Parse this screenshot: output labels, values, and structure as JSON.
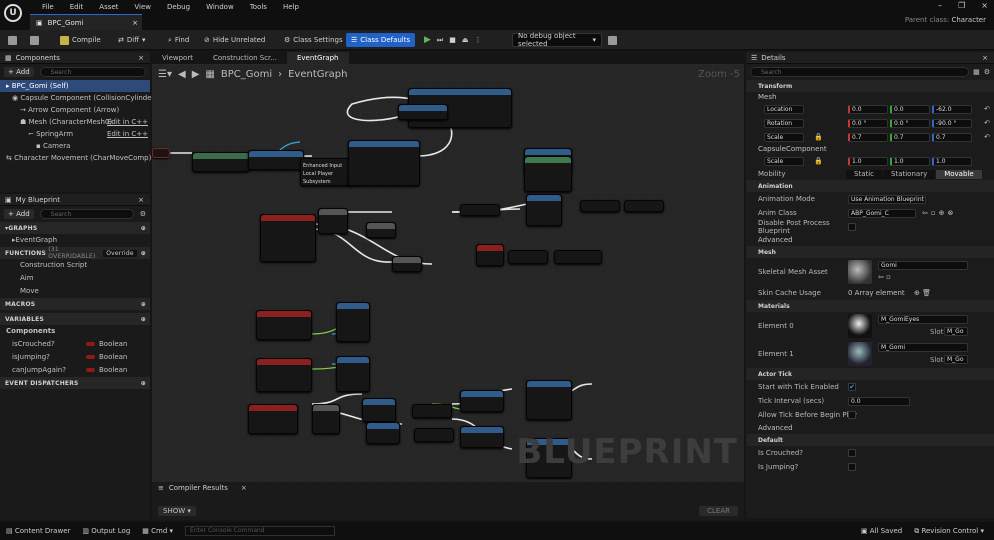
{
  "app": {
    "logo": "U",
    "doc_tab": "BPC_Gomi",
    "parent_label": "Parent class:",
    "parent_value": "Character"
  },
  "menu": [
    "File",
    "Edit",
    "Asset",
    "View",
    "Debug",
    "Window",
    "Tools",
    "Help"
  ],
  "toolbar": {
    "compile": "Compile",
    "diff": "Diff",
    "find": "Find",
    "hide_unrelated": "Hide Unrelated",
    "class_settings": "Class Settings",
    "class_defaults": "Class Defaults",
    "debug_object": "No debug object selected"
  },
  "components": {
    "title": "Components",
    "add": "+ Add",
    "search_placeholder": "Search",
    "tree": [
      {
        "label": "BPC_Gomi (Self)",
        "extra": ""
      },
      {
        "label": "Capsule Component (CollisionCylinder)",
        "extra": ""
      },
      {
        "label": "Arrow Component (Arrow)",
        "extra": "Edit in C++"
      },
      {
        "label": "Mesh (CharacterMesh0)",
        "extra": "Edit in C++"
      },
      {
        "label": "SpringArm",
        "extra": ""
      },
      {
        "label": "Camera",
        "extra": ""
      },
      {
        "label": "Character Movement (CharMoveComp)",
        "extra": ""
      }
    ]
  },
  "my_blueprint": {
    "title": "My Blueprint",
    "add": "+ Add",
    "search_placeholder": "Search",
    "graphs": "GRAPHS",
    "event_graph": "EventGraph",
    "functions": "FUNCTIONS",
    "functions_count": "(31 OVERRIDABLE)",
    "override": "Override",
    "function_items": [
      "Construction Script",
      "Aim",
      "Move"
    ],
    "macros": "MACROS",
    "variables": "VARIABLES",
    "components_cat": "Components",
    "vars": [
      {
        "name": "isCrouched?",
        "type": "Boolean"
      },
      {
        "name": "isJumping?",
        "type": "Boolean"
      },
      {
        "name": "canJumpAgain?",
        "type": "Boolean"
      }
    ],
    "dispatchers": "EVENT DISPATCHERS"
  },
  "graph_tabs": [
    "Viewport",
    "Construction Scr...",
    "EventGraph"
  ],
  "breadcrumb": {
    "root": "BPC_Gomi",
    "page": "EventGraph"
  },
  "graph": {
    "zoom": "Zoom -5",
    "watermark": "BLUEPRINT",
    "node_text": "Enhanced Input Local Player Subsystem"
  },
  "compiler": {
    "title": "Compiler Results",
    "show": "SHOW",
    "clear": "CLEAR"
  },
  "details": {
    "title": "Details",
    "search_placeholder": "Search",
    "transform": "Transform",
    "mesh": "Mesh",
    "location": {
      "label": "Location",
      "x": "0.0",
      "y": "0.0",
      "z": "-62.0"
    },
    "rotation": {
      "label": "Rotation",
      "x": "0.0 °",
      "y": "0.0 °",
      "z": "-90.0 °"
    },
    "scale": {
      "label": "Scale",
      "x": "0.7",
      "y": "0.7",
      "z": "0.7"
    },
    "capsule": "CapsuleComponent",
    "cscale": {
      "label": "Scale",
      "x": "1.0",
      "y": "1.0",
      "z": "1.0"
    },
    "mobility": {
      "label": "Mobility",
      "opts": [
        "Static",
        "Stationary",
        "Movable"
      ]
    },
    "animation": "Animation",
    "anim_mode": {
      "label": "Animation Mode",
      "value": "Use Animation Blueprint"
    },
    "anim_class": {
      "label": "Anim Class",
      "value": "ABP_Gomi_C"
    },
    "disable_pp": "Disable Post Process Blueprint",
    "advanced": "Advanced",
    "mesh_sec": "Mesh",
    "skel_mesh": {
      "label": "Skeletal Mesh Asset",
      "value": "Gomi"
    },
    "skin_cache": {
      "label": "Skin Cache Usage",
      "value": "0 Array element"
    },
    "materials": "Materials",
    "el0": {
      "label": "Element 0",
      "value": "M_GomiEyes",
      "slot": "Slot",
      "slotval": "M_Go"
    },
    "el1": {
      "label": "Element 1",
      "value": "M_Gomi",
      "slot": "Slot",
      "slotval": "M_Go"
    },
    "actor_tick": "Actor Tick",
    "start_tick": "Start with Tick Enabled",
    "tick_interval": {
      "label": "Tick Interval (secs)",
      "value": "0.0"
    },
    "allow_tick": "Allow Tick Before Begin Play",
    "advanced2": "Advanced",
    "default": "Default",
    "is_crouched": "Is Crouched?",
    "is_jumping": "Is Jumping?"
  },
  "status": {
    "drawer": "Content Drawer",
    "output": "Output Log",
    "cmd": "Cmd",
    "console_placeholder": "Enter Console Command",
    "saved": "All Saved",
    "revision": "Revision Control"
  }
}
